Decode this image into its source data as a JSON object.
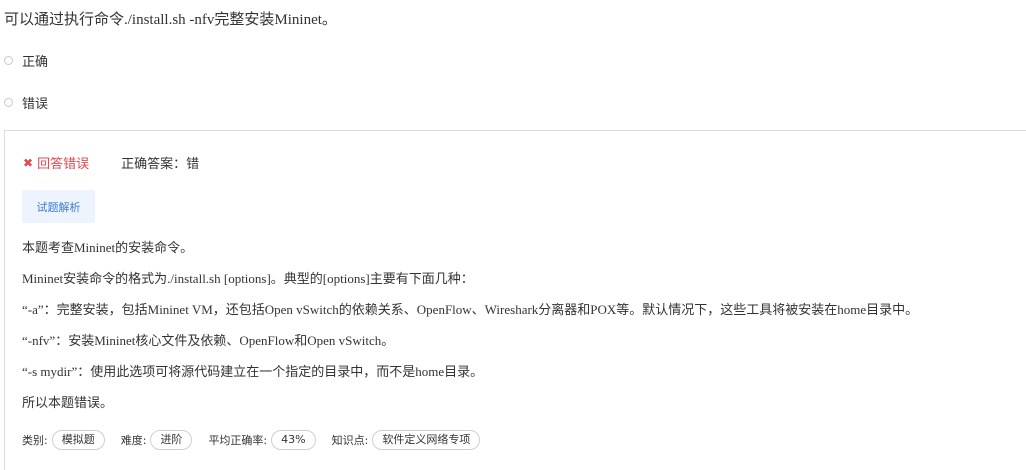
{
  "question": {
    "text": "可以通过执行命令./install.sh -nfv完整安装Mininet。"
  },
  "options": [
    {
      "label": "正确"
    },
    {
      "label": "错误"
    }
  ],
  "result": {
    "status_icon": "close-icon",
    "status_text": "回答错误",
    "correct_answer": "正确答案：错",
    "status_color": "#e5484d"
  },
  "analysis": {
    "tab_label": "试题解析",
    "paragraphs": [
      "本题考查Mininet的安装命令。",
      "Mininet安装命令的格式为./install.sh [options]。典型的[options]主要有下面几种：",
      "“-a”：完整安装，包括Mininet VM，还包括Open vSwitch的依赖关系、OpenFlow、Wireshark分离器和POX等。默认情况下，这些工具将被安装在home目录中。",
      "“-nfv”：安装Mininet核心文件及依赖、OpenFlow和Open vSwitch。",
      "“-s mydir”：使用此选项可将源代码建立在一个指定的目录中，而不是home目录。",
      "所以本题错误。"
    ]
  },
  "meta": {
    "category_label": "类别:",
    "category_value": "模拟题",
    "difficulty_label": "难度:",
    "difficulty_value": "进阶",
    "accuracy_label": "平均正确率:",
    "accuracy_value": "43%",
    "knowledge_label": "知识点:",
    "knowledge_value": "软件定义网络专项"
  },
  "colors": {
    "accent_blue": "#3b7bd6",
    "tab_bg": "#eef4fd",
    "error_red": "#e5484d"
  }
}
